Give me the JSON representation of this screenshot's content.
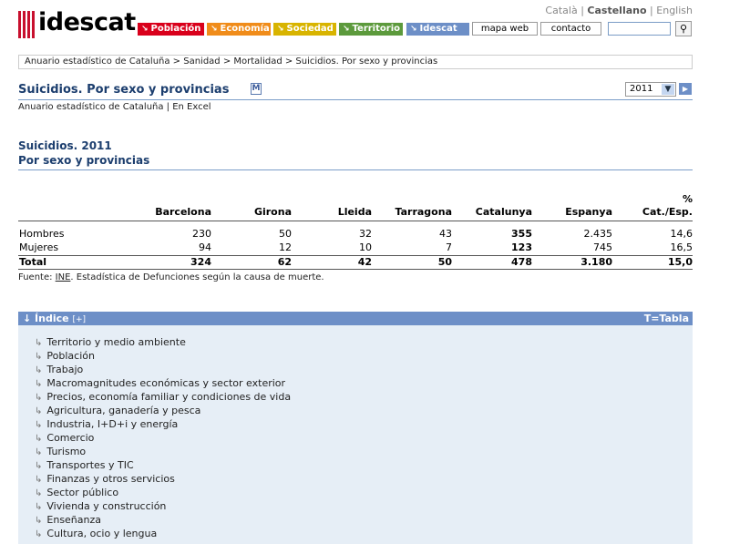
{
  "brand": {
    "name": "idescat"
  },
  "languages": {
    "catala": "Català",
    "sep1": "|",
    "castellano": "Castellano",
    "sep2": "|",
    "english": "English"
  },
  "nav": {
    "tabs": [
      {
        "label": "Población",
        "color": "#d9001b"
      },
      {
        "label": "Economía",
        "color": "#f08c1a"
      },
      {
        "label": "Sociedad",
        "color": "#d8b400"
      },
      {
        "label": "Territorio",
        "color": "#5c9a3c"
      },
      {
        "label": "Idescat",
        "color": "#6d8fc7"
      }
    ],
    "mapa_web": "mapa web",
    "contacto": "contacto"
  },
  "breadcrumb": "Anuario estadístico de Cataluña > Sanidad > Mortalidad > Suicidios. Por sexo y provincias",
  "page": {
    "title": "Suicidios. Por sexo y provincias",
    "m_icon": "M",
    "subtitle": "Anuario estadístico de Cataluña | En Excel",
    "year": "2011"
  },
  "table": {
    "title_line1": "Suicidios. 2011",
    "title_line2": "Por sexo y provincias",
    "pct_label": "%",
    "columns": [
      "Barcelona",
      "Girona",
      "Lleida",
      "Tarragona",
      "Catalunya",
      "Espanya",
      "Cat./Esp."
    ],
    "rows": [
      {
        "label": "Hombres",
        "values": [
          "230",
          "50",
          "32",
          "43",
          "355",
          "2.435",
          "14,6"
        ]
      },
      {
        "label": "Mujeres",
        "values": [
          "94",
          "12",
          "10",
          "7",
          "123",
          "745",
          "16,5"
        ]
      },
      {
        "label": "Total",
        "values": [
          "324",
          "62",
          "42",
          "50",
          "478",
          "3.180",
          "15,0"
        ]
      }
    ],
    "source_prefix": "Fuente: ",
    "source_link": "INE",
    "source_rest": ". Estadística de Defunciones según la causa de muerte."
  },
  "index": {
    "title": "↓ Índice",
    "toggle": "[+]",
    "legend": "T=Tabla",
    "items": [
      "Territorio y medio ambiente",
      "Población",
      "Trabajo",
      "Macromagnitudes económicas y sector exterior",
      "Precios, economía familiar y condiciones de vida",
      "Agricultura, ganadería y pesca",
      "Industria, I+D+i y energía",
      "Comercio",
      "Turismo",
      "Transportes y TIC",
      "Finanzas y otros servicios",
      "Sector público",
      "Vivienda y construcción",
      "Enseñanza",
      "Cultura, ocio y lengua"
    ]
  }
}
